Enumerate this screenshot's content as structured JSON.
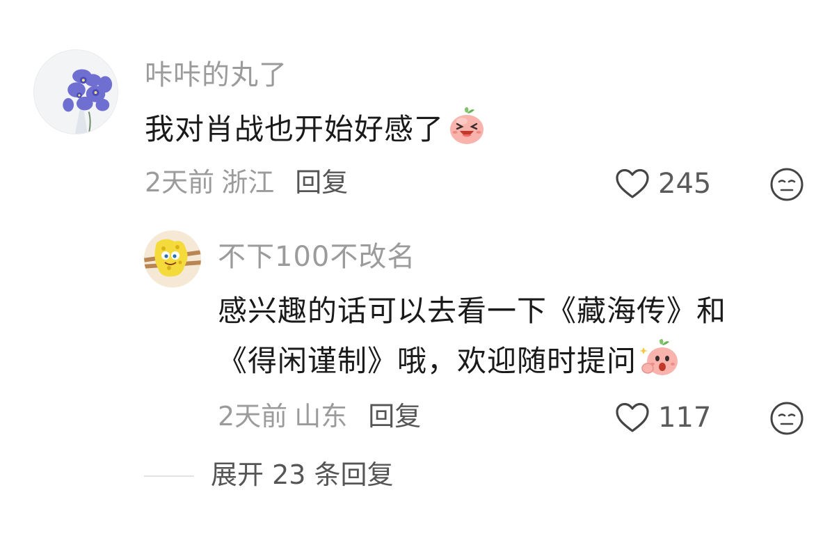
{
  "comments": [
    {
      "username": "咔咔的丸了",
      "text": "我对肖战也开始好感了",
      "emoji": "laughing-peach-emoji",
      "time": "2天前",
      "location": "浙江",
      "reply_label": "回复",
      "likes": "245",
      "avatar": "purple-flowers-avatar"
    },
    {
      "username": "不下100不改名",
      "text_line1": "感兴趣的话可以去看一下《藏海传》和",
      "text_line2": "《得闲谨制》哦，欢迎随时提问",
      "emoji": "excited-peach-emoji",
      "time": "2天前",
      "location": "山东",
      "reply_label": "回复",
      "likes": "117",
      "avatar": "sponge-cartoon-avatar"
    }
  ],
  "expand": {
    "label": "展开 23 条回复"
  },
  "colors": {
    "username": "#9b9b9b",
    "text": "#1a1a1a",
    "secondary": "#555555",
    "peach": "#f6a9a3"
  }
}
